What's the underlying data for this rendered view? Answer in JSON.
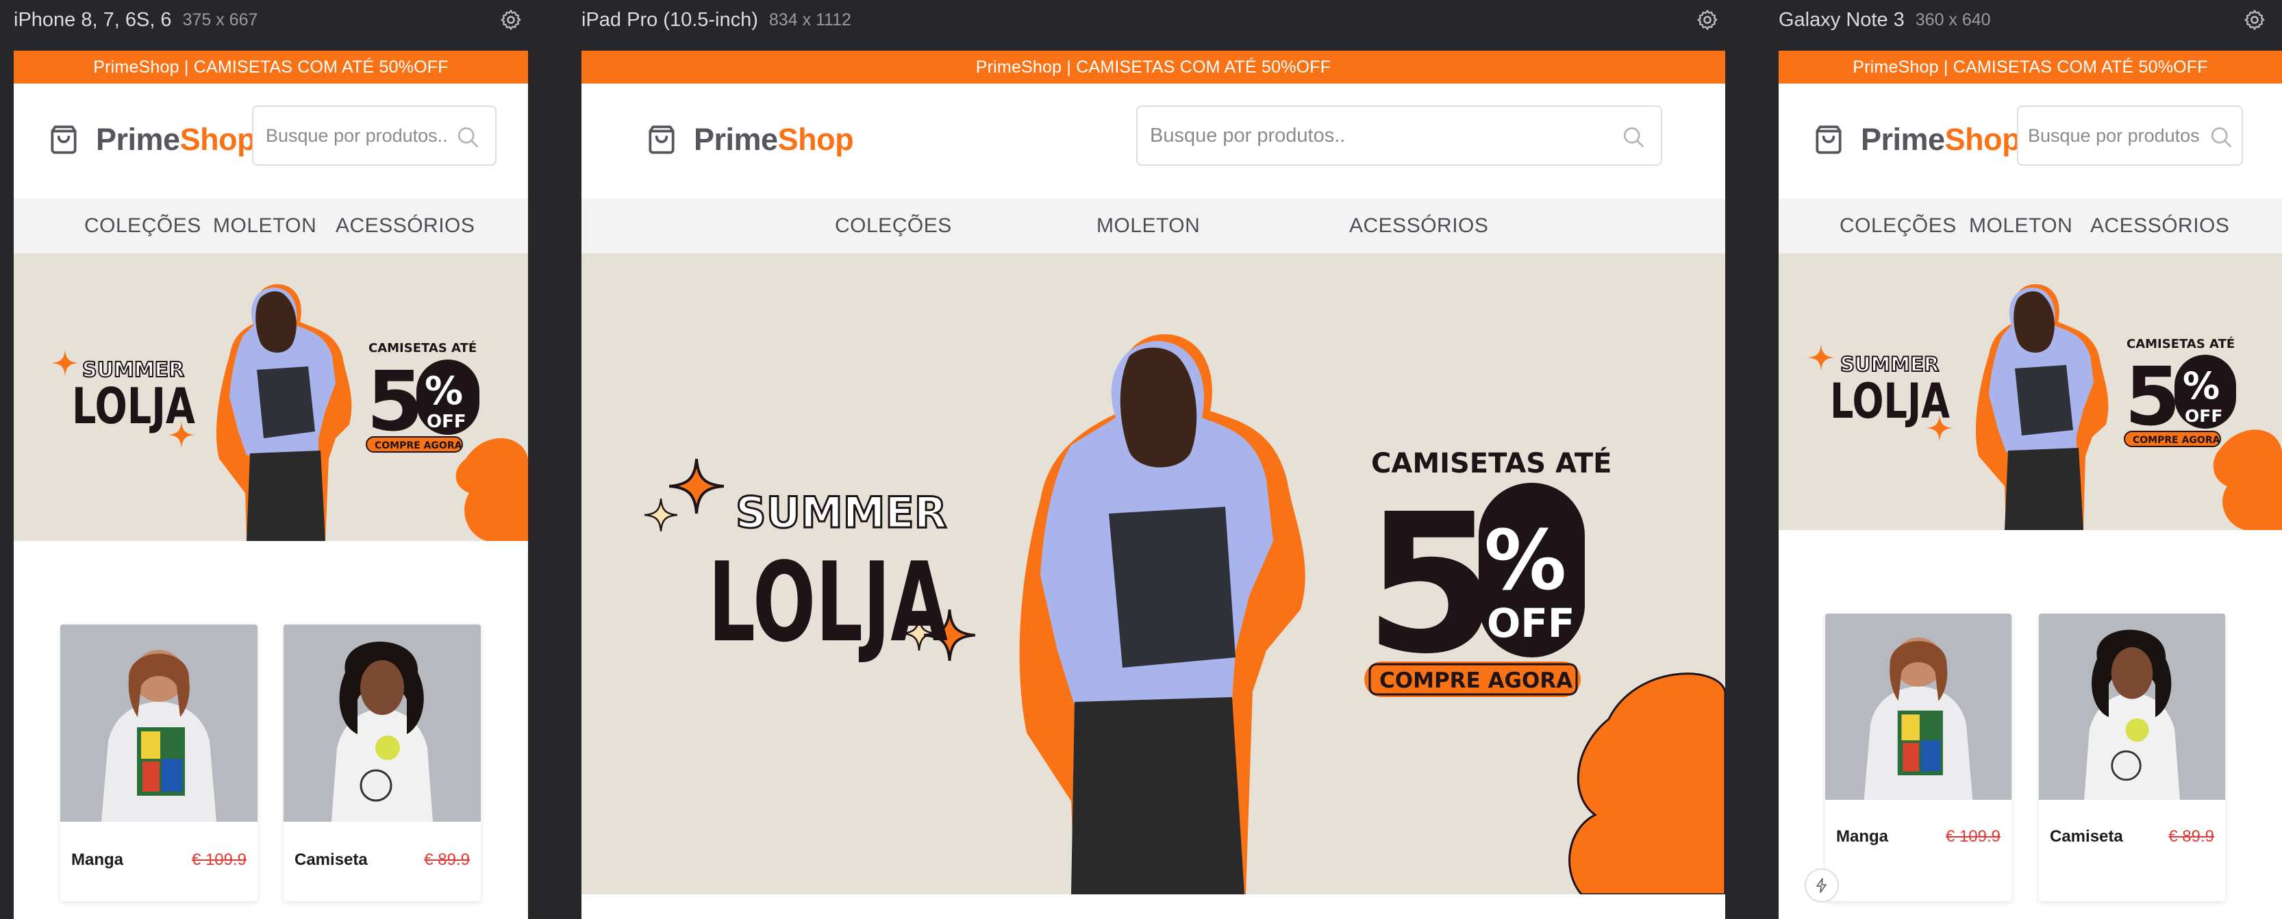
{
  "devices": [
    {
      "name": "iPhone 8, 7, 6S, 6",
      "size": "375 x 667"
    },
    {
      "name": "iPad Pro (10.5-inch)",
      "size": "834 x 1112"
    },
    {
      "name": "Galaxy Note 3",
      "size": "360 x 640"
    }
  ],
  "site": {
    "promo": "PrimeShop | CAMISETAS COM ATÉ 50%OFF",
    "logo_prime": "Prime",
    "logo_shop": "Shop",
    "search_placeholder": "Busque por produtos..",
    "search_placeholder_short": "Busque por produtos",
    "nav": [
      "COLEÇÕES",
      "MOLETON",
      "ACESSÓRIOS"
    ],
    "banner": {
      "summer": "SUMMER",
      "lolja": "LOLJA",
      "camisetas": "CAMISETAS ATÉ",
      "fifty": "5",
      "zero": "0",
      "percent": "%",
      "off": "OFF",
      "cta": "COMPRE AGORA"
    },
    "products": [
      {
        "name": "Manga",
        "price": "€ 109.9"
      },
      {
        "name": "Camiseta",
        "price": "€ 89.9"
      }
    ]
  },
  "colors": {
    "accent": "#f97316",
    "frame_bg": "#272729",
    "price": "#e53935",
    "banner_bg": "#e6e1d6"
  }
}
